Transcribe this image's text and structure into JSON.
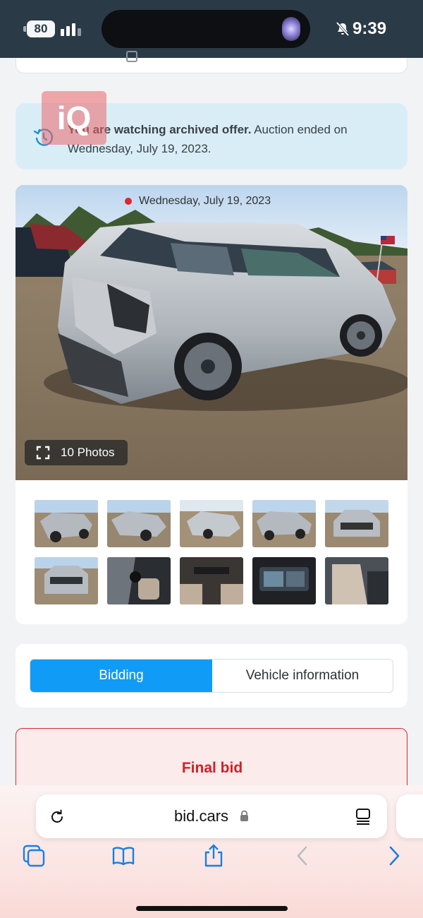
{
  "status_bar": {
    "battery": "80",
    "time": "9:39",
    "icons": [
      "signal-bars-icon",
      "flashlight-icon",
      "bell-slash-icon"
    ]
  },
  "notice": {
    "bold_text": "You are watching archived offer.",
    "rest_text": " Auction ended on Wednesday, July 19, 2023.",
    "icon": "history-icon",
    "watermark": "iQ",
    "background": "#d9edf6"
  },
  "gallery": {
    "date": "Wednesday, July 19, 2023",
    "photos_button": "10 Photos",
    "thumbnail_count": 10,
    "dot_color": "#e1262c"
  },
  "tabs": {
    "items": [
      {
        "label": "Bidding",
        "active": true
      },
      {
        "label": "Vehicle information",
        "active": false
      }
    ],
    "accent": "#109bf6"
  },
  "final_bid": {
    "title": "Final bid",
    "color": "#d21f25"
  },
  "browser": {
    "url": "bid.cars",
    "icons": [
      "reload-icon",
      "lock-icon",
      "reader-icon",
      "tabs-icon",
      "bookmarks-icon",
      "share-icon",
      "back-icon",
      "forward-icon"
    ]
  }
}
